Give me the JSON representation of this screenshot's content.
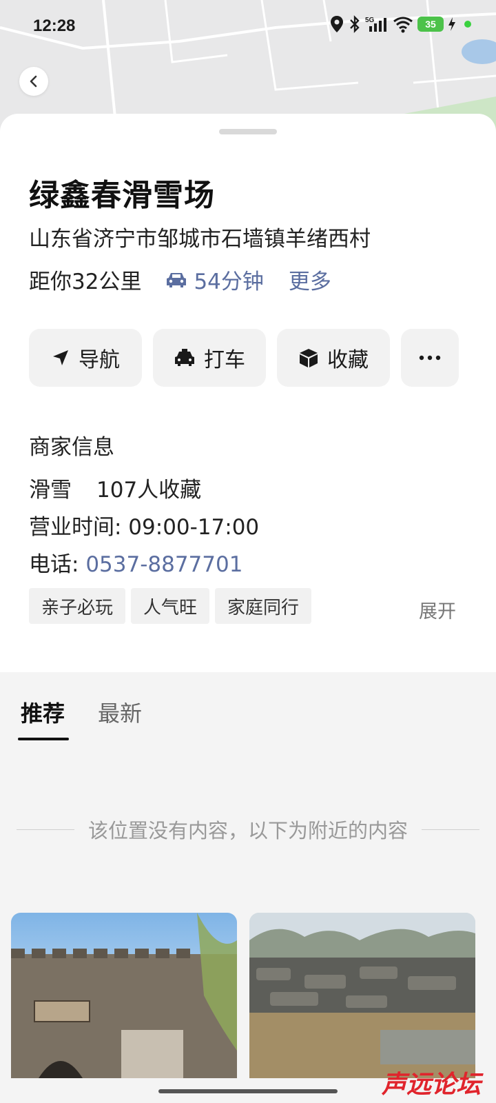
{
  "status_bar": {
    "time": "12:28",
    "battery": "35"
  },
  "place": {
    "name": "绿鑫春滑雪场",
    "address": "山东省济宁市邹城市石墙镇羊绪西村",
    "distance": "距你32公里",
    "drive_time": "54分钟",
    "more": "更多"
  },
  "actions": [
    {
      "label": "导航",
      "icon": "navigate-arrow-icon"
    },
    {
      "label": "打车",
      "icon": "taxi-icon"
    },
    {
      "label": "收藏",
      "icon": "box-icon"
    },
    {
      "label": "",
      "icon": "more-dots-icon"
    }
  ],
  "business": {
    "heading": "商家信息",
    "category": "滑雪",
    "favorites": "107人收藏",
    "hours": "营业时间: 09:00-17:00",
    "phone_label": "电话: ",
    "phone": "0537-8877701",
    "tags": [
      "亲子必玩",
      "人气旺",
      "家庭同行"
    ],
    "expand": "展开"
  },
  "tabs": [
    "推荐",
    "最新"
  ],
  "notice": "该位置没有内容，以下为附近的内容",
  "watermark": "声远论坛",
  "colors": {
    "link": "#5b6ea0",
    "battery": "#4cc24a",
    "watermark": "#e0242c"
  }
}
